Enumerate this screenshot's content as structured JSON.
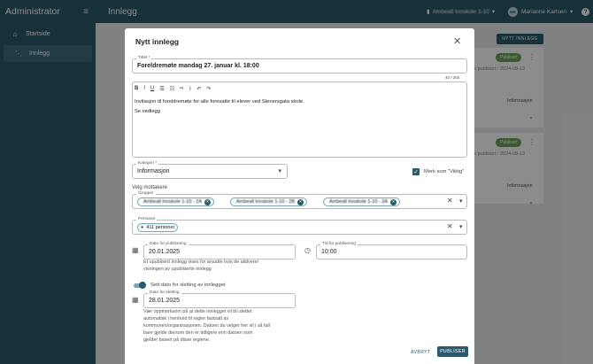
{
  "app": {
    "brand": "Administrator",
    "page_title": "Innlegg",
    "school": "Ambeall Innskole 1-10",
    "user_initials": "MK",
    "user_name": "Marianne Karlsen",
    "help": "?"
  },
  "sidebar": {
    "items": [
      {
        "label": "Startside",
        "icon": "home-icon"
      },
      {
        "label": "Innlegg",
        "icon": "rss-icon"
      }
    ]
  },
  "background": {
    "new_post_button": "NYTT INNLEGG",
    "cards": [
      {
        "badge": "Publisert",
        "text": "e publisert : 2024-08-13",
        "extra": "Informasjon"
      },
      {
        "badge": "Publisert",
        "text": "e publisert : 2024-08-13",
        "extra": "Informasjon"
      }
    ]
  },
  "modal": {
    "title": "Nytt innlegg",
    "title_field": {
      "label": "Tittel *",
      "value": "Foreldremøte mandag 27. januar kl. 18:00",
      "counter": "40 / 255"
    },
    "editor": {
      "lines": [
        "Invitasjon til foreldremøte for alle foresatte til elever ved Stenersgata skole.",
        "Se vedlegg"
      ]
    },
    "category": {
      "label": "Kategori *",
      "value": "Informasjon"
    },
    "important_checkbox": {
      "label": "Merk som \"Viktig\"",
      "checked": true
    },
    "recipients_heading": "Velg mottakere",
    "groups": {
      "label": "Grupper",
      "chips": [
        "Ambeall Innskole 1-10 - 2A",
        "Ambeall Innskole 1-10 - 2B",
        "Ambeall Innskole 1-10 - 3A"
      ]
    },
    "persons": {
      "label": "Personer",
      "chip": "411 personer"
    },
    "publish_date": {
      "label": "Dato for publisering",
      "value": "20.01.2025"
    },
    "publish_time": {
      "label": "Tid for publisering",
      "value": "10:00"
    },
    "publish_help": [
      "Et upublisert innlegg vises for ansatte hvis de aktiverer",
      "visningen av upubliserte innlegg"
    ],
    "delete_toggle": {
      "label": "Sett dato for sletting av innlegget",
      "on": true
    },
    "delete_date": {
      "label": "Dato for sletting",
      "value": "28.01.2025"
    },
    "delete_help": [
      "Vær oppmerksom på at dette innlegget vil bli slettet",
      "automatisk i henhold til regler fastsatt av",
      "kommunen/organisasjonen. Datoen du velger her vil i så fall",
      "bare gjelde dersom den er tidligere enn datoen som",
      "gjelder basert på disse reglene."
    ],
    "cancel_button": "AVBRYT",
    "publish_button": "PUBLISER"
  }
}
